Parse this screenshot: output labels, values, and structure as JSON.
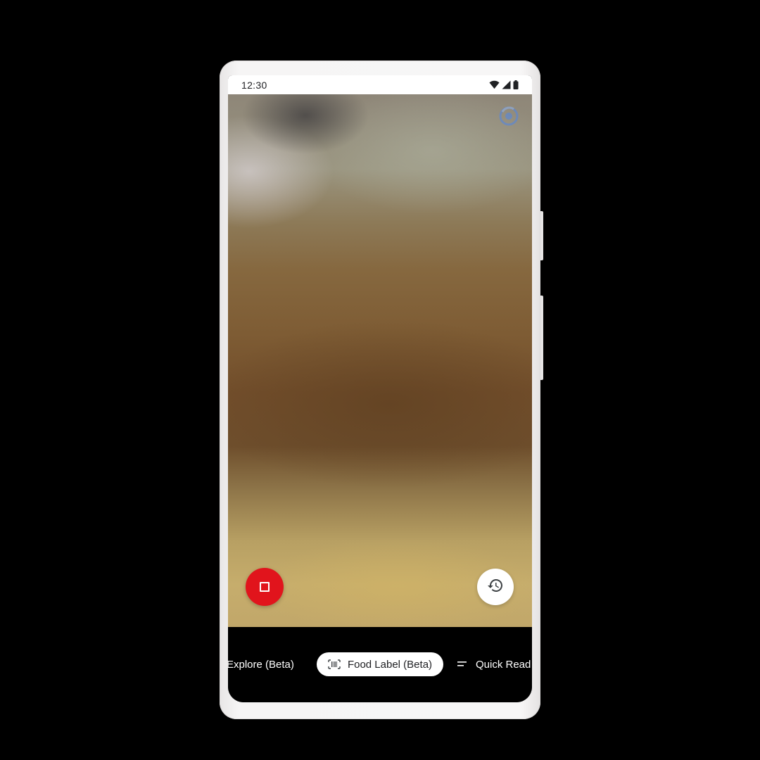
{
  "status_bar": {
    "time": "12:30",
    "icons": [
      "wifi-icon",
      "signal-icon",
      "battery-icon"
    ]
  },
  "viewfinder": {
    "lens_icon": "lens-icon",
    "stop_button_icon": "stop-icon",
    "history_button_icon": "history-icon"
  },
  "modes": {
    "items": [
      {
        "label": "Explore (Beta)",
        "icon": null,
        "selected": false
      },
      {
        "label": "Food Label (Beta)",
        "icon": "barcode-icon",
        "selected": true
      },
      {
        "label": "Quick Read",
        "icon": "text-lines-icon",
        "selected": false
      }
    ]
  },
  "colors": {
    "stop_button": "#e1141c",
    "selected_mode_bg": "#ffffff",
    "mode_bar_bg": "#000000",
    "lens_icon": "#4f86e8"
  }
}
